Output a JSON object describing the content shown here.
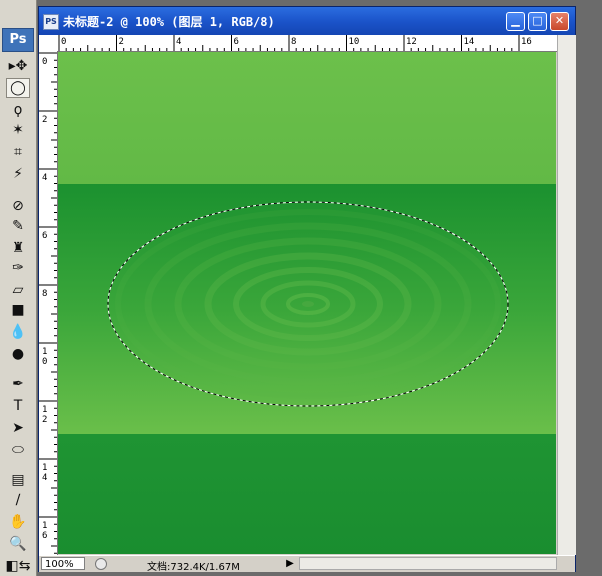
{
  "window": {
    "title": "未标题-2 @ 100% (图层 1, RGB/8)",
    "doc_icon": "PS",
    "buttons": [
      "minimize",
      "maximize",
      "close"
    ]
  },
  "toolbox": {
    "logo": "Ps",
    "tools": [
      {
        "name": "move-tool-icon",
        "glyph": "▸✥"
      },
      {
        "name": "elliptical-marquee-tool-icon",
        "glyph": "◯",
        "active": true
      },
      {
        "name": "lasso-tool-icon",
        "glyph": "ϙ"
      },
      {
        "name": "magic-wand-tool-icon",
        "glyph": "✶"
      },
      {
        "name": "crop-tool-icon",
        "glyph": "⌗"
      },
      {
        "name": "slice-tool-icon",
        "glyph": "⚡"
      },
      {
        "name": "healing-brush-tool-icon",
        "glyph": "⊘"
      },
      {
        "name": "brush-tool-icon",
        "glyph": "✎"
      },
      {
        "name": "clone-stamp-tool-icon",
        "glyph": "♜"
      },
      {
        "name": "history-brush-tool-icon",
        "glyph": "✑"
      },
      {
        "name": "eraser-tool-icon",
        "glyph": "▱"
      },
      {
        "name": "gradient-tool-icon",
        "glyph": "■"
      },
      {
        "name": "blur-tool-icon",
        "glyph": "💧"
      },
      {
        "name": "dodge-tool-icon",
        "glyph": "●"
      },
      {
        "name": "pen-tool-icon",
        "glyph": "✒"
      },
      {
        "name": "type-tool-icon",
        "glyph": "T"
      },
      {
        "name": "path-selection-tool-icon",
        "glyph": "➤"
      },
      {
        "name": "shape-tool-icon",
        "glyph": "⬭"
      },
      {
        "name": "notes-tool-icon",
        "glyph": "▤"
      },
      {
        "name": "eyedropper-tool-icon",
        "glyph": "∕"
      },
      {
        "name": "hand-tool-icon",
        "glyph": "✋"
      },
      {
        "name": "zoom-tool-icon",
        "glyph": "🔍"
      },
      {
        "name": "color-swatches-icon",
        "glyph": "◧⇆"
      }
    ]
  },
  "ruler": {
    "horizontal_labels": [
      "0",
      "2",
      "4",
      "6",
      "8",
      "10",
      "12",
      "14",
      "16"
    ],
    "vertical_labels": [
      "0",
      "2",
      "4",
      "6",
      "8",
      "1 0",
      "1 2",
      "1 4",
      "1 6"
    ]
  },
  "canvas": {
    "colors": {
      "light_green": "#6dbf4a",
      "dark_green": "#1e9232",
      "mid_green": "#3aa83c"
    },
    "selection": "elliptical marquee"
  },
  "statusbar": {
    "zoom": "100%",
    "doc_info": "文档:732.4K/1.67M",
    "menu_arrow": "▶"
  }
}
